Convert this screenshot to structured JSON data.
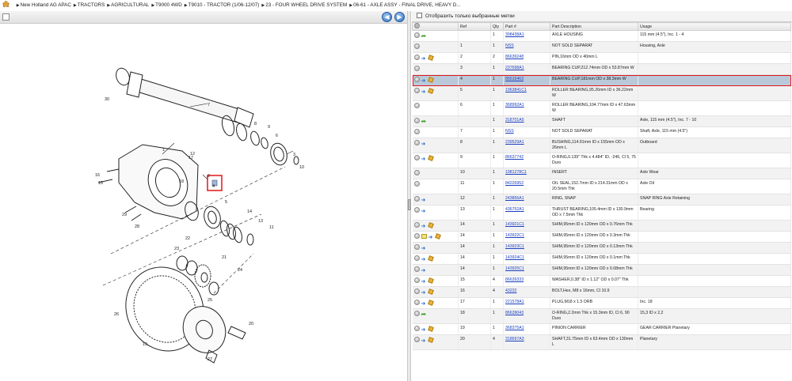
{
  "breadcrumb": {
    "home_icon": "home-icon",
    "items": [
      "New Holland AG APAC",
      "TRACTORS",
      "AGRICULTURAL",
      "T9000 4WD",
      "T9010 - TRACTOR (1/06-12/07)",
      "23 - FOUR WHEEL DRIVE SYSTEM",
      "06-61 - AXLE ASSY - FINAL DRIVE, HEAVY D..."
    ]
  },
  "filter": {
    "label": "Отобразить только выбранные метки",
    "checked": false
  },
  "table": {
    "columns": [
      "",
      "Ref",
      "Qty",
      "Part #",
      "Part Description",
      "Usage"
    ],
    "rows": [
      {
        "icons": [
          "circle",
          "arrow"
        ],
        "ref": "",
        "qty": "1",
        "part": "398438A1",
        "desc": "AXLE HOUSING",
        "usage": "115 mm (4.5\"), Inc. 1 - 4"
      },
      {
        "icons": [
          "circle"
        ],
        "ref": "1",
        "qty": "1",
        "part": "NSS",
        "desc": "NOT SOLD SEPARAT",
        "usage": "Housing, Axle"
      },
      {
        "icons": [
          "circle",
          "info",
          "box"
        ],
        "ref": "2",
        "qty": "2",
        "part": "86639248",
        "desc": "PIN,16mm OD x 40mm L",
        "usage": ""
      },
      {
        "icons": [
          "circle"
        ],
        "ref": "3",
        "qty": "1",
        "part": "237698A1",
        "desc": "BEARING CUP,212.74mm OD x 53.87mm W",
        "usage": ""
      },
      {
        "icons": [
          "circle",
          "info",
          "box"
        ],
        "ref": "4",
        "qty": "1",
        "part": "86516463",
        "desc": "BEARING CUP,181mm OD x 38.3mm W",
        "usage": "",
        "selected": true
      },
      {
        "icons": [
          "circle",
          "info",
          "box"
        ],
        "ref": "5",
        "qty": "1",
        "part": "1963841C1",
        "desc": "ROLLER BEARING,95.26mm ID x 36.22mm W",
        "usage": ""
      },
      {
        "icons": [
          "circle"
        ],
        "ref": "6",
        "qty": "1",
        "part": "368992A1",
        "desc": "ROLLER BEARING,104.77mm ID x 47.63mm W",
        "usage": ""
      },
      {
        "icons": [
          "circle",
          "arrow"
        ],
        "ref": "",
        "qty": "1",
        "part": "318701A5",
        "desc": "SHAFT",
        "usage": "Axle, 115 mm (4.5\"), Inc. 7 - 10"
      },
      {
        "icons": [
          "circle"
        ],
        "ref": "7",
        "qty": "1",
        "part": "NSS",
        "desc": "NOT SOLD SEPARAT",
        "usage": "Shaft, Axle, 115 mm (4.5\")"
      },
      {
        "icons": [
          "circle",
          "info"
        ],
        "ref": "8",
        "qty": "1",
        "part": "239529A1",
        "desc": "BUSHING,114.91mm ID x 155mm OD x 26mm L",
        "usage": "Outboard"
      },
      {
        "icons": [
          "circle",
          "info",
          "box"
        ],
        "ref": "9",
        "qty": "1",
        "part": "86637742",
        "desc": "O-RING,0.139\" Thk x 4.484\" ID, -246, Cl 5, 75 Duro",
        "usage": ""
      },
      {
        "icons": [
          "circle"
        ],
        "ref": "10",
        "qty": "1",
        "part": "1981278C1",
        "desc": "INSERT",
        "usage": "Axle Wear"
      },
      {
        "icons": [
          "circle"
        ],
        "ref": "11",
        "qty": "1",
        "part": "84226952",
        "desc": "OIL SEAL,152.7mm ID x 214.31mm OD x 20.5mm Thk",
        "usage": "Axle Oil"
      },
      {
        "icons": [
          "circle",
          "info"
        ],
        "ref": "12",
        "qty": "1",
        "part": "243856A1",
        "desc": "RING, SNAP",
        "usage": "SNAP RING Axle Retaining"
      },
      {
        "icons": [
          "circle",
          "info"
        ],
        "ref": "13",
        "qty": "1",
        "part": "436752A1",
        "desc": "THRUST BEARING,105.4mm ID x 130.9mm OD x 7.5mm Thk",
        "usage": "Bearing"
      },
      {
        "icons": [
          "circle",
          "info",
          "box"
        ],
        "ref": "14",
        "qty": "1",
        "part": "143921C1",
        "desc": "SHIM,95mm ID x 120mm OD x 0.76mm Thk",
        "usage": ""
      },
      {
        "icons": [
          "circle",
          "note",
          "info",
          "box"
        ],
        "ref": "14",
        "qty": "1",
        "part": "143922C1",
        "desc": "SHIM,95mm ID x 120mm OD x 0.3mm Thk",
        "usage": ""
      },
      {
        "icons": [
          "circle",
          "info"
        ],
        "ref": "14",
        "qty": "1",
        "part": "143923C1",
        "desc": "SHIM,95mm ID x 120mm OD x 0.13mm Thk",
        "usage": ""
      },
      {
        "icons": [
          "circle",
          "info",
          "box"
        ],
        "ref": "14",
        "qty": "1",
        "part": "143924C1",
        "desc": "SHIM,95mm ID x 120mm OD x 0.1mm Thk",
        "usage": ""
      },
      {
        "icons": [
          "circle",
          "info"
        ],
        "ref": "14",
        "qty": "1",
        "part": "143925C1",
        "desc": "SHIM,95mm ID x 120mm OD x 0.08mm Thk",
        "usage": ""
      },
      {
        "icons": [
          "circle",
          "info",
          "box"
        ],
        "ref": "15",
        "qty": "4",
        "part": "86639333",
        "desc": "WASHER,0.38\" ID x 1.12\" OD x 0.07\" Thk",
        "usage": ""
      },
      {
        "icons": [
          "circle",
          "info",
          "box"
        ],
        "ref": "16",
        "qty": "4",
        "part": "43232",
        "desc": "BOLT,Hex, M8 x 16mm, Cl 10.9",
        "usage": ""
      },
      {
        "icons": [
          "circle",
          "info",
          "box"
        ],
        "ref": "17",
        "qty": "1",
        "part": "221578A1",
        "desc": "PLUG,M18 x 1.5 ORB",
        "usage": "Inc. 18"
      },
      {
        "icons": [
          "circle",
          "arrow"
        ],
        "ref": "18",
        "qty": "1",
        "part": "86639043",
        "desc": "O-RING,2.2mm Thk x 15.3mm ID, Cl 6, 90 Duro",
        "usage": "15,3 ID x 2,2"
      },
      {
        "icons": [
          "circle",
          "info",
          "box"
        ],
        "ref": "19",
        "qty": "1",
        "part": "368375A1",
        "desc": "PINION CARRIER",
        "usage": "GEAR CARRIER Planetary"
      },
      {
        "icons": [
          "circle",
          "info",
          "box"
        ],
        "ref": "20",
        "qty": "4",
        "part": "318697A3",
        "desc": "SHAFT,31.75mm ID x 63.4mm OD x 130mm L",
        "usage": "Planetary"
      }
    ]
  },
  "diagram": {
    "callouts": [
      "1",
      "2",
      "3",
      "4",
      "5",
      "6",
      "7",
      "8",
      "9",
      "10",
      "11",
      "12",
      "13",
      "14",
      "15",
      "16",
      "17",
      "18",
      "19",
      "20",
      "21",
      "22",
      "23",
      "24",
      "25",
      "26",
      "27",
      "28",
      "29",
      "30"
    ],
    "highlighted_ref": "4"
  },
  "colors": {
    "selection_outline": "#e0161b",
    "selected_row": "#b9c9d9",
    "link": "#1a3fbf"
  }
}
